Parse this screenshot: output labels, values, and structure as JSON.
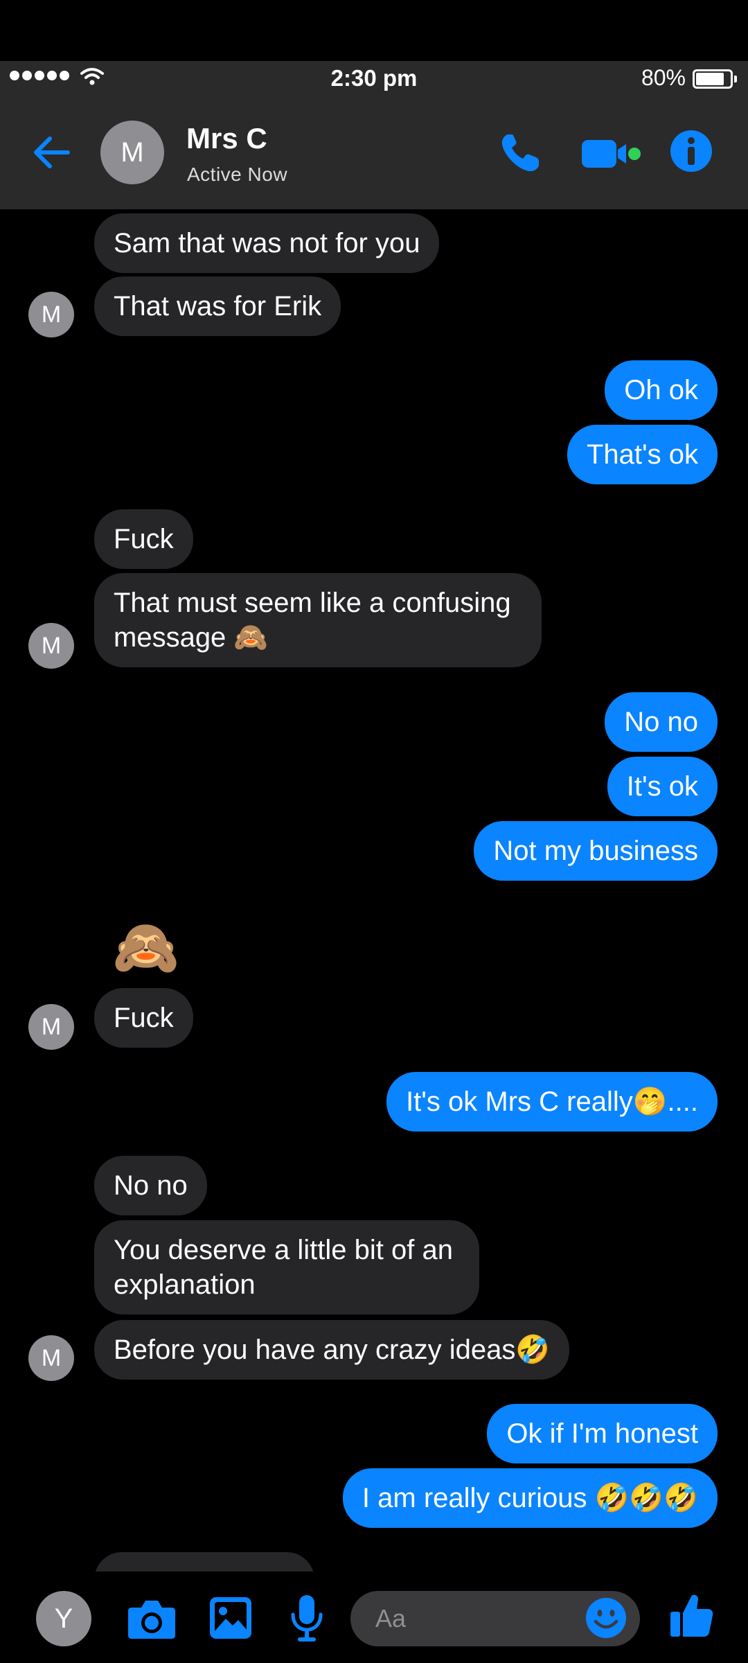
{
  "status_bar": {
    "time": "2:30 pm",
    "battery": "80%"
  },
  "header": {
    "avatar_letter": "M",
    "name": "Mrs C",
    "status": "Active Now"
  },
  "messages": [
    {
      "side": "in",
      "text": "Sam that was not for you"
    },
    {
      "side": "in",
      "text": "That was for Erik"
    },
    {
      "side": "out",
      "text": "Oh ok"
    },
    {
      "side": "out",
      "text": "That's ok"
    },
    {
      "side": "in",
      "text": "Fuck"
    },
    {
      "side": "in",
      "text": "That must seem like a confusing message 🙈"
    },
    {
      "side": "out",
      "text": "No no"
    },
    {
      "side": "out",
      "text": "It's ok"
    },
    {
      "side": "out",
      "text": "Not my business"
    },
    {
      "side": "in",
      "text": "🙈"
    },
    {
      "side": "in",
      "text": "Fuck"
    },
    {
      "side": "out",
      "text": "It's ok Mrs C really🤭...."
    },
    {
      "side": "in",
      "text": "No no"
    },
    {
      "side": "in",
      "text": "You deserve a little bit of an explanation"
    },
    {
      "side": "in",
      "text": "Before you have any crazy ideas🤣"
    },
    {
      "side": "out",
      "text": "Ok if I'm honest"
    },
    {
      "side": "out",
      "text": "I am really curious 🤣🤣🤣"
    }
  ],
  "avatars": {
    "contact_letter": "M",
    "user_letter": "Y"
  },
  "composer": {
    "placeholder": "Aa"
  },
  "icons": {
    "back": "back-arrow-icon",
    "call": "phone-icon",
    "video": "video-camera-icon",
    "info": "info-icon",
    "camera": "camera-icon",
    "gallery": "gallery-icon",
    "mic": "microphone-icon",
    "emoji": "smiley-icon",
    "like": "thumbs-up-icon"
  },
  "colors": {
    "accent": "#0a84ff",
    "incoming_bubble": "#262629",
    "header_bg": "#2a2a2a",
    "online_dot": "#30d158"
  }
}
